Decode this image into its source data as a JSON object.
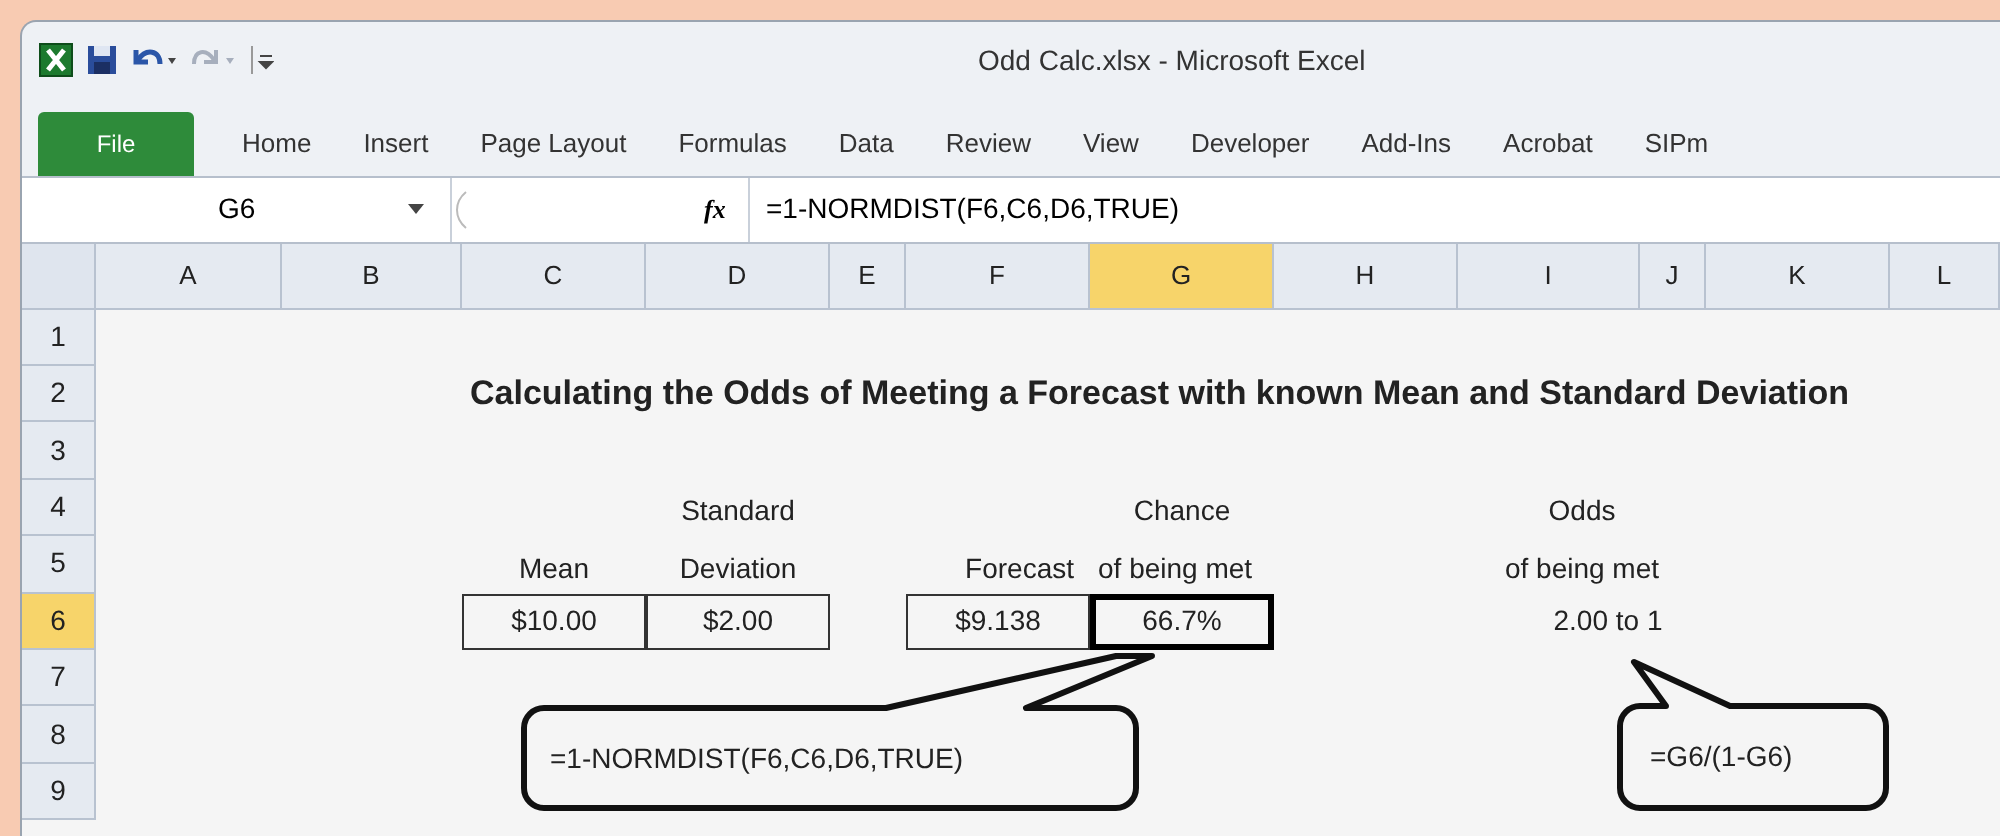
{
  "window": {
    "title": "Odd Calc.xlsx - Microsoft Excel"
  },
  "ribbon_tabs": [
    {
      "label": "File",
      "kind": "file"
    },
    {
      "label": "Home",
      "kind": "tab"
    },
    {
      "label": "Insert",
      "kind": "tab"
    },
    {
      "label": "Page Layout",
      "kind": "tab"
    },
    {
      "label": "Formulas",
      "kind": "tab"
    },
    {
      "label": "Data",
      "kind": "tab"
    },
    {
      "label": "Review",
      "kind": "tab"
    },
    {
      "label": "View",
      "kind": "tab"
    },
    {
      "label": "Developer",
      "kind": "tab"
    },
    {
      "label": "Add-Ins",
      "kind": "tab"
    },
    {
      "label": "Acrobat",
      "kind": "tab"
    },
    {
      "label": "SIPm",
      "kind": "tab"
    }
  ],
  "formula_bar": {
    "name_box": "G6",
    "fx": "fx",
    "formula": "=1-NORMDIST(F6,C6,D6,TRUE)"
  },
  "columns": [
    {
      "label": "A",
      "selected": false
    },
    {
      "label": "B",
      "selected": false
    },
    {
      "label": "C",
      "selected": false
    },
    {
      "label": "D",
      "selected": false
    },
    {
      "label": "E",
      "selected": false
    },
    {
      "label": "F",
      "selected": false
    },
    {
      "label": "G",
      "selected": true
    },
    {
      "label": "H",
      "selected": false
    },
    {
      "label": "I",
      "selected": false
    },
    {
      "label": "J",
      "selected": false
    },
    {
      "label": "K",
      "selected": false
    },
    {
      "label": "L",
      "selected": false
    }
  ],
  "rows": [
    {
      "label": "1",
      "selected": false
    },
    {
      "label": "2",
      "selected": false
    },
    {
      "label": "3",
      "selected": false
    },
    {
      "label": "4",
      "selected": false
    },
    {
      "label": "5",
      "selected": false
    },
    {
      "label": "6",
      "selected": true
    },
    {
      "label": "7",
      "selected": false
    },
    {
      "label": "8",
      "selected": false
    },
    {
      "label": "9",
      "selected": false
    }
  ],
  "sheet_title": "Calculating the Odds of Meeting a Forecast with known Mean and Standard Deviation",
  "fields": [
    {
      "label": "Mean",
      "value": "$10.00",
      "boxed": true,
      "selected": false
    },
    {
      "label_top": "Standard",
      "label": "Deviation",
      "value": "$2.00",
      "boxed": true,
      "selected": false
    },
    {
      "label": "Forecast",
      "value": "$9.138",
      "boxed": true,
      "selected": false
    },
    {
      "label_top": "Chance",
      "label": "of being met",
      "value": "66.7%",
      "boxed": true,
      "selected": true
    },
    {
      "label_top": "Odds",
      "label": "of being met",
      "value": "2.00 to  1",
      "boxed": false,
      "selected": false
    }
  ],
  "callouts": [
    {
      "text": "=1-NORMDIST(F6,C6,D6,TRUE)"
    },
    {
      "text": "=G6/(1-G6)"
    }
  ]
}
